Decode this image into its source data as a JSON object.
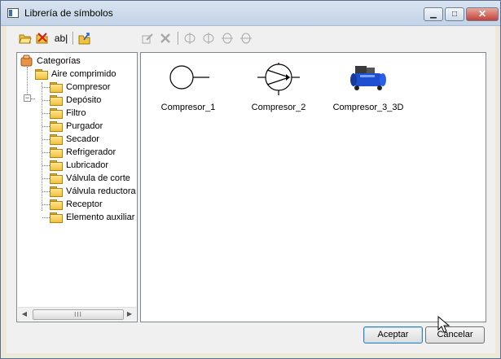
{
  "window": {
    "title": "Librería de símbolos",
    "controls": {
      "minimize": "▁",
      "maximize": "□",
      "close": "✕"
    }
  },
  "toolbar": {
    "icons": [
      "open-folder-icon",
      "delete-icon",
      "rename-icon",
      "import-icon",
      "edit-icon",
      "remove-icon",
      "rotate-left-icon",
      "rotate-right-icon",
      "flip-horizontal-icon",
      "flip-vertical-icon"
    ],
    "rename_label": "ab|"
  },
  "tree": {
    "root": "Categorías",
    "group": "Aire comprimido",
    "items": [
      "Compresor",
      "Depósito",
      "Filtro",
      "Purgador",
      "Secador",
      "Refrigerador",
      "Lubricador",
      "Válvula de corte",
      "Válvula reductora",
      "Receptor",
      "Elemento auxiliar"
    ],
    "expander": "−",
    "scroll_grip": "III",
    "scroll_left": "◀",
    "scroll_right": "▶"
  },
  "gallery": {
    "symbols": [
      {
        "label": "Compresor_1"
      },
      {
        "label": "Compresor_2"
      },
      {
        "label": "Compresor_3_3D"
      }
    ]
  },
  "buttons": {
    "accept": "Aceptar",
    "cancel": "Cancelar"
  },
  "colors": {
    "accent": "#3c7fb1",
    "compressor_blue": "#1f4fd1"
  }
}
